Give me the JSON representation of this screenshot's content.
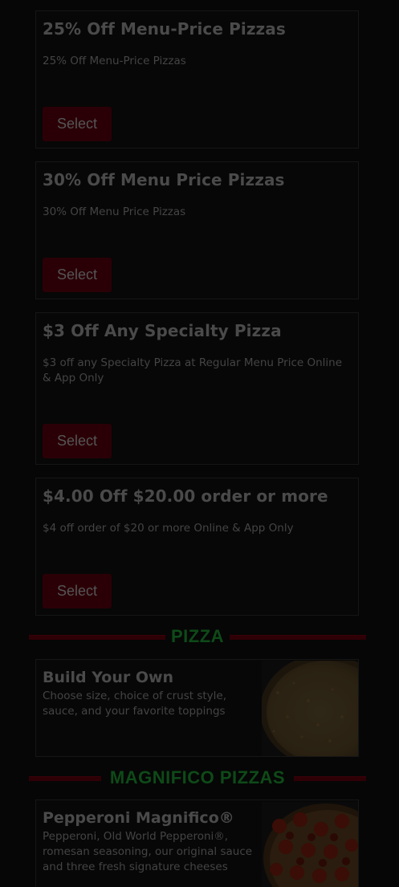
{
  "deals": [
    {
      "title": "25% Off Menu-Price Pizzas",
      "description": "25% Off Menu-Price Pizzas",
      "button_label": "Select"
    },
    {
      "title": "30% Off Menu Price Pizzas",
      "description": "30% Off Menu Price Pizzas",
      "button_label": "Select"
    },
    {
      "title": "$3 Off Any Specialty Pizza",
      "description": "$3 off any Specialty Pizza at Regular Menu Price Online & App Only",
      "button_label": "Select"
    },
    {
      "title": "$4.00 Off $20.00 order or more",
      "description": "$4 off order of $20 or more Online & App Only",
      "button_label": "Select"
    }
  ],
  "sections": [
    {
      "title": "PIZZA",
      "items": [
        {
          "title": "Build Your Own",
          "description": "Choose size, choice of crust style, sauce, and your favorite toppings",
          "image_icon": "cheese-pizza-image"
        }
      ]
    },
    {
      "title": "MAGNIFICO PIZZAS",
      "items": [
        {
          "title": "Pepperoni Magnifico®",
          "description": "Pepperoni, Old World Pepperoni®, romesan seasoning, our original sauce and three fresh signature cheeses",
          "image_icon": "pepperoni-pizza-image"
        }
      ]
    }
  ],
  "colors": {
    "overlay_background": "#060606",
    "button_background": "#2a0006",
    "section_title": "#0e4a18",
    "section_rule": "#2e0006"
  }
}
